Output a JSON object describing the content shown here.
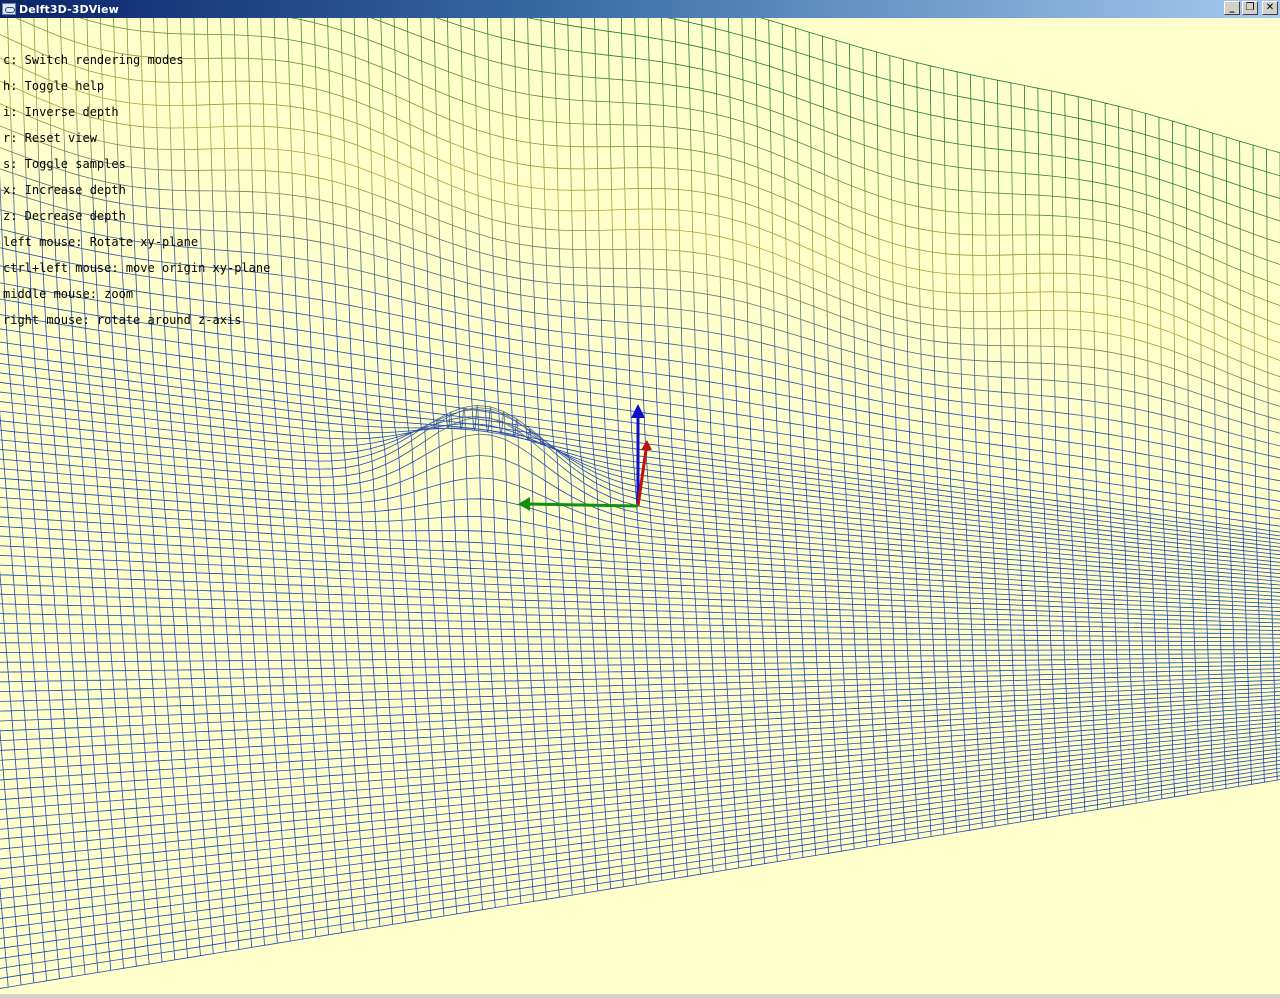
{
  "window": {
    "title": "Delft3D-3DView",
    "controls": {
      "minimize": "_",
      "restore": "❐",
      "close": "✕"
    }
  },
  "help_lines": [
    "c: Switch rendering modes",
    "h: Toggle help",
    "i: Inverse depth",
    "r: Reset view",
    "s: Toggle samples",
    "x: Increase depth",
    "z: Decrease depth",
    "left mouse: Rotate xy-plane",
    "ctrl+left mouse: move origin xy-plane",
    "middle mouse: zoom",
    "right mouse: rotate around z-axis"
  ],
  "colors": {
    "background": "#ffffcc",
    "mesh_low": "#1f49b0",
    "mesh_high": "#b0a832",
    "mesh_peak": "#1f7a3a",
    "axis_x": "#c01010",
    "axis_y": "#109010",
    "axis_z": "#1010c8"
  },
  "icons": [
    "app-icon",
    "minimize-icon",
    "restore-icon",
    "close-icon"
  ]
}
